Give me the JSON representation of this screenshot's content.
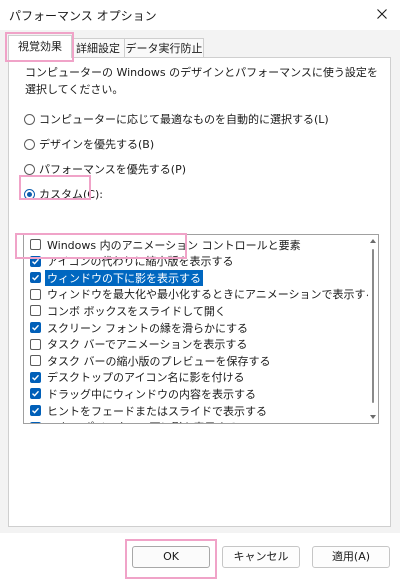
{
  "window": {
    "title": "パフォーマンス オプション",
    "close_icon": "close-icon"
  },
  "tabs": [
    {
      "label": "視覚効果",
      "active": true
    },
    {
      "label": "詳細設定",
      "active": false
    },
    {
      "label": "データ実行防止",
      "active": false
    }
  ],
  "panel": {
    "description": "コンピューターの Windows のデザインとパフォーマンスに使う設定を選択してください。",
    "options": [
      {
        "label": "コンピューターに応じて最適なものを自動的に選択する(L)",
        "selected": false
      },
      {
        "label": "デザインを優先する(B)",
        "selected": false
      },
      {
        "label": "パフォーマンスを優先する(P)",
        "selected": false
      },
      {
        "label": "カスタム(C):",
        "selected": true
      }
    ],
    "effects": [
      {
        "label": "Windows 内のアニメーション コントロールと要素",
        "checked": false
      },
      {
        "label": "アイコンの代わりに縮小版を表示する",
        "checked": true
      },
      {
        "label": "ウィンドウの下に影を表示する",
        "checked": true,
        "selected": true
      },
      {
        "label": "ウィンドウを最大化や最小化するときにアニメーションで表示する",
        "checked": false
      },
      {
        "label": "コンボ ボックスをスライドして開く",
        "checked": false
      },
      {
        "label": "スクリーン フォントの縁を滑らかにする",
        "checked": true
      },
      {
        "label": "タスク バーでアニメーションを表示する",
        "checked": false
      },
      {
        "label": "タスク バーの縮小版のプレビューを保存する",
        "checked": false
      },
      {
        "label": "デスクトップのアイコン名に影を付ける",
        "checked": true
      },
      {
        "label": "ドラッグ中にウィンドウの内容を表示する",
        "checked": true
      },
      {
        "label": "ヒントをフェードまたはスライドで表示する",
        "checked": true
      },
      {
        "label": "マウス ポインターの下に影を表示する",
        "checked": true
      }
    ]
  },
  "buttons": {
    "ok": "OK",
    "cancel": "キャンセル",
    "apply": "適用(A)"
  },
  "colors": {
    "highlight_frame": "#f0a3c8",
    "selection": "#0067c0",
    "checkbox_checked": "#005fb8"
  }
}
